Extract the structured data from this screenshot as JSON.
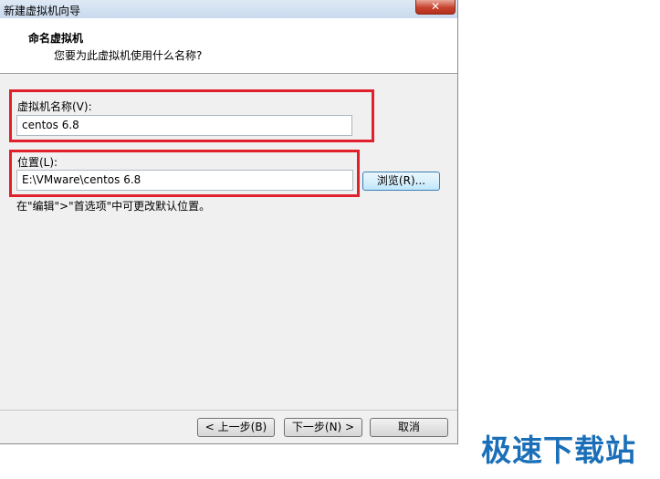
{
  "window": {
    "title": "新建虚拟机向导",
    "close_glyph": "✕"
  },
  "header": {
    "title": "命名虚拟机",
    "subtitle": "您要为此虚拟机使用什么名称?"
  },
  "name_field": {
    "label": "虚拟机名称(V):",
    "value": "centos 6.8"
  },
  "location_field": {
    "label": "位置(L):",
    "value": "E:\\VMware\\centos 6.8"
  },
  "browse_button": {
    "label": "浏览(R)..."
  },
  "hint_text": "在\"编辑\">\"首选项\"中可更改默认位置。",
  "footer": {
    "back": "< 上一步(B)",
    "next": "下一步(N) >",
    "cancel": "取消"
  },
  "watermark": "极速下载站",
  "colors": {
    "highlight_red": "#e0202a",
    "watermark_blue": "#1a6fb8"
  }
}
